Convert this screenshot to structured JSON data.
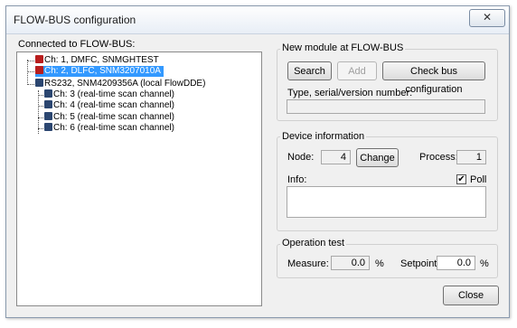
{
  "window": {
    "title": "FLOW-BUS configuration",
    "close_glyph": "✕"
  },
  "tree_panel": {
    "label": "Connected to FLOW-BUS:",
    "items": [
      {
        "text": "Ch: 1, DMFC, SNMGHTEST",
        "icon": "device-icon",
        "selected": false
      },
      {
        "text": "Ch: 2, DLFC, SNM3207010A",
        "icon": "device-icon",
        "selected": true
      },
      {
        "text": "RS232, SNM4209356A (local FlowDDE)",
        "icon": "computer-icon",
        "selected": false
      },
      {
        "text": "Ch: 3 (real-time scan channel)",
        "icon": "computer-icon",
        "selected": false
      },
      {
        "text": "Ch: 4 (real-time scan channel)",
        "icon": "computer-icon",
        "selected": false
      },
      {
        "text": "Ch: 5 (real-time scan channel)",
        "icon": "computer-icon",
        "selected": false
      },
      {
        "text": "Ch: 6 (real-time scan channel)",
        "icon": "computer-icon",
        "selected": false
      }
    ]
  },
  "new_module": {
    "title": "New module at FLOW-BUS",
    "search_label": "Search",
    "add_label": "Add",
    "check_label": "Check bus configuration",
    "type_label": "Type, serial/version number:",
    "type_value": ""
  },
  "device_info": {
    "title": "Device information",
    "node_label": "Node:",
    "node_value": "4",
    "change_label": "Change",
    "process_label": "Process:",
    "process_value": "1",
    "info_label": "Info:",
    "info_value": "",
    "poll_label": "Poll",
    "poll_checked": true,
    "check_glyph": "✔"
  },
  "operation_test": {
    "title": "Operation test",
    "measure_label": "Measure:",
    "measure_value": "0.0",
    "measure_unit": "%",
    "setpoint_label": "Setpoint",
    "setpoint_value": "0.0",
    "setpoint_unit": "%"
  },
  "footer": {
    "close_label": "Close"
  },
  "colors": {
    "selection": "#3399ff",
    "dialog_bg": "#f0f0f0"
  }
}
